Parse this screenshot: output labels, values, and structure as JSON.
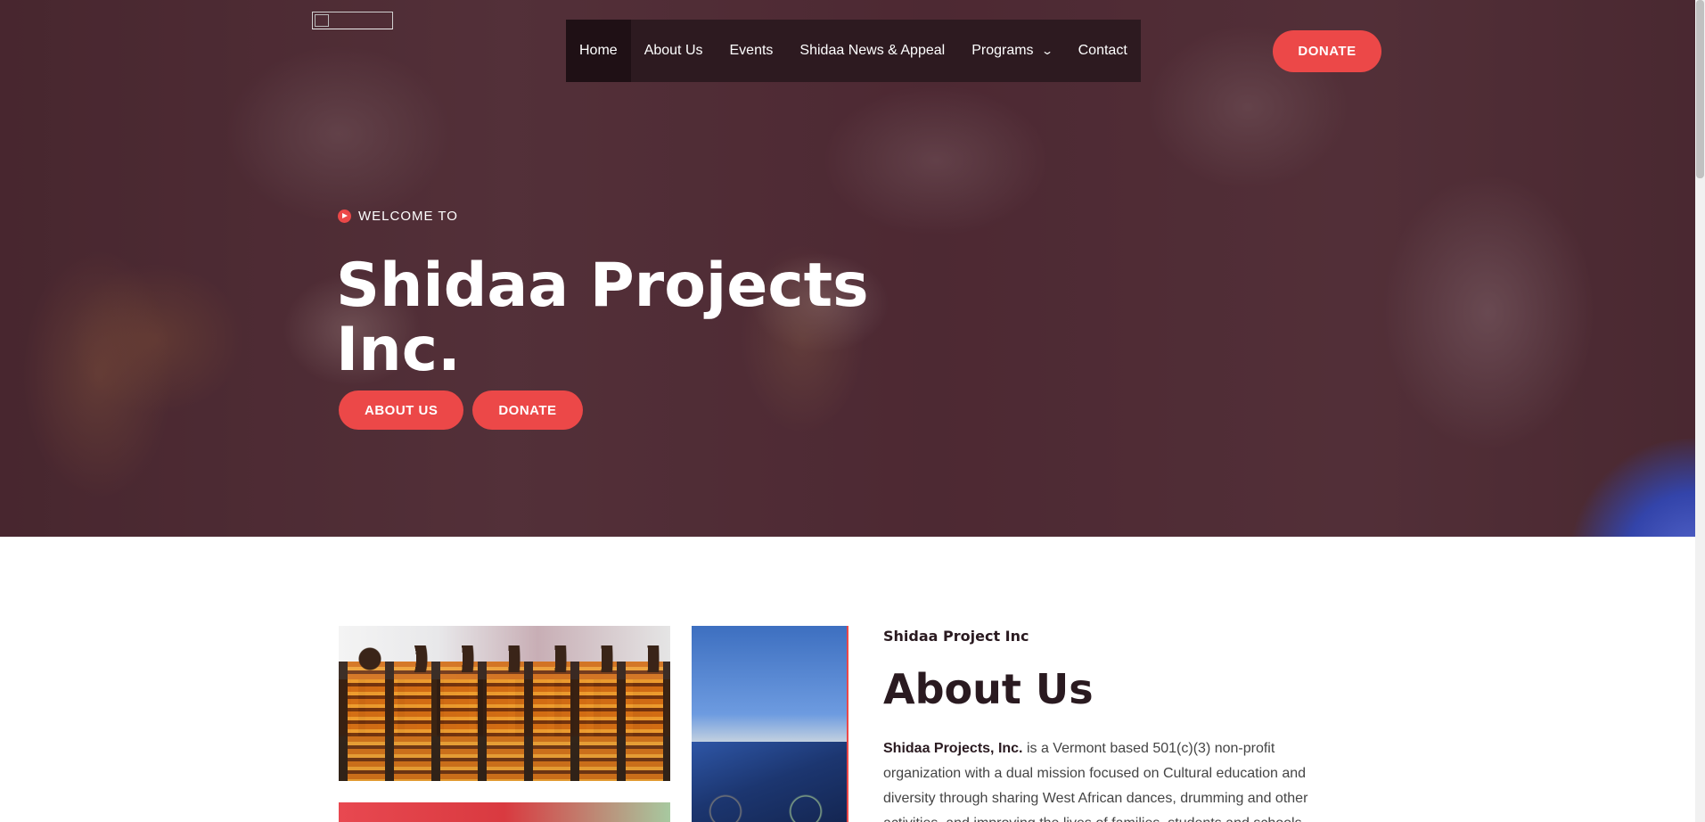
{
  "header": {
    "nav": [
      {
        "label": "Home",
        "active": true
      },
      {
        "label": "About Us",
        "active": false
      },
      {
        "label": "Events",
        "active": false
      },
      {
        "label": "Shidaa News & Appeal",
        "active": false
      },
      {
        "label": "Programs",
        "active": false,
        "has_dropdown": true
      },
      {
        "label": "Contact",
        "active": false
      }
    ],
    "donate_label": "DONATE"
  },
  "hero": {
    "eyebrow": "WELCOME TO",
    "title": "Shidaa Projects Inc.",
    "buttons": {
      "about": "ABOUT US",
      "donate": "DONATE"
    }
  },
  "about": {
    "eyebrow": "Shidaa Project Inc",
    "title": "About Us",
    "body_strong": "Shidaa Projects, Inc.",
    "body_rest": " is a Vermont based 501(c)(3) non-profit organization with a dual mission focused on Cultural education and diversity through sharing West African dances, drumming and other activities, and improving the lives of families, students and schools through our Help"
  },
  "colors": {
    "accent": "#ec4848",
    "nav_bg": "#2d1a20",
    "heading": "#2a1a20"
  },
  "icons": {
    "welcome": "play-circle-icon",
    "dropdown": "chevron-down-icon"
  }
}
